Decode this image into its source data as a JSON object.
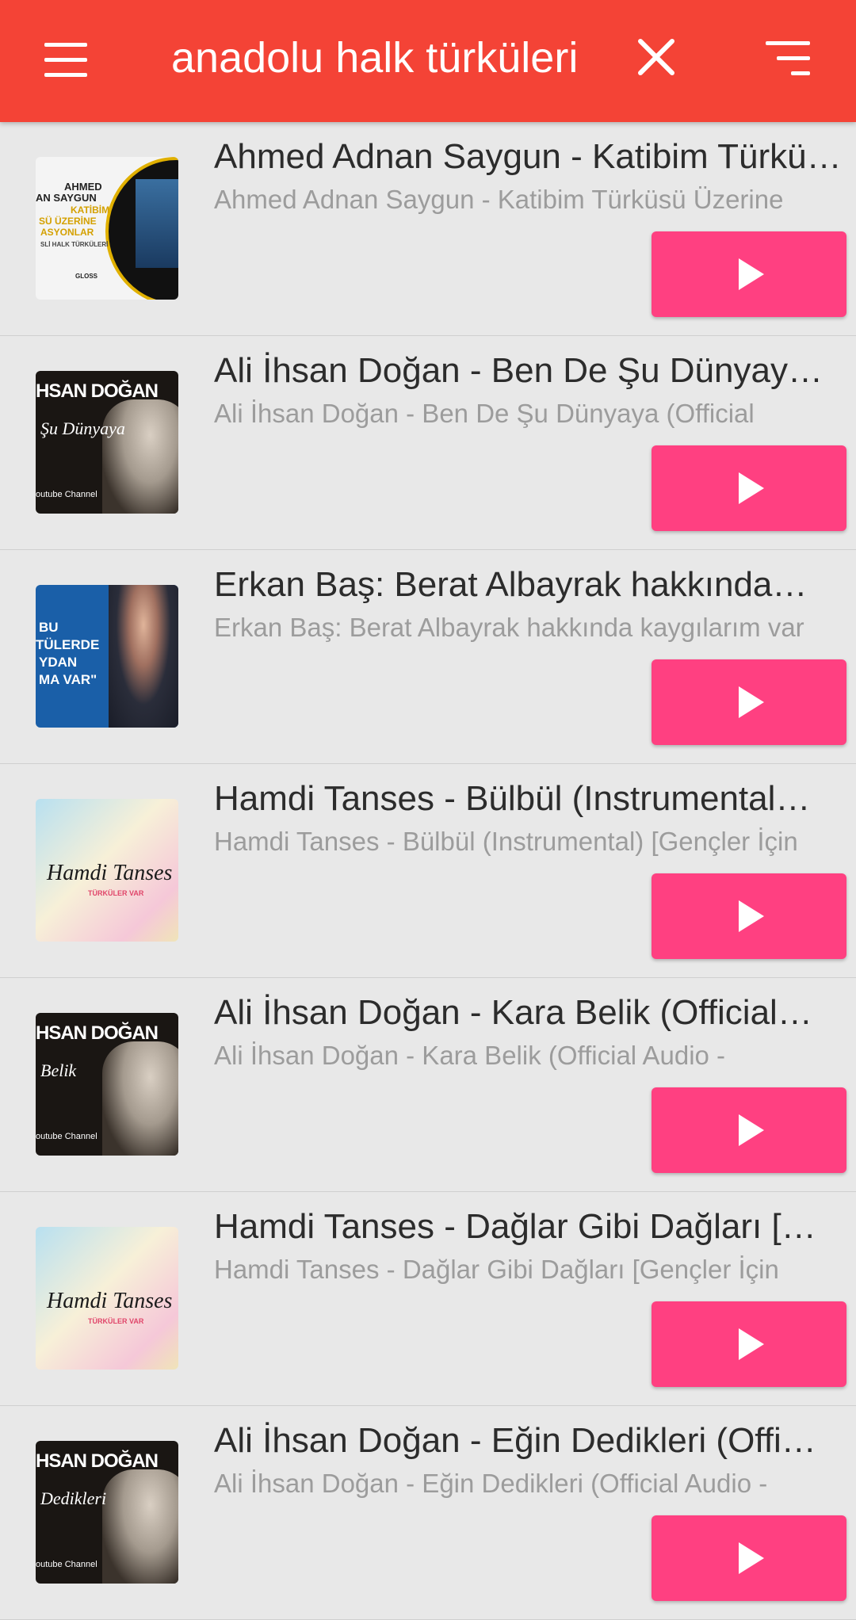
{
  "appbar": {
    "title": "anadolu halk türküleri",
    "icons": {
      "menu": "menu-icon",
      "close": "close-icon",
      "sort": "sort-icon"
    },
    "color": "#f44336"
  },
  "accent_color": "#ff4081",
  "items": [
    {
      "title": "Ahmed Adnan Saygun - Katibim Türkü…",
      "subtitle": "Ahmed Adnan Saygun - Katibim Türküsü Üzerine",
      "thumb_style": "white",
      "thumb_lines": [
        "AHMED",
        "AN SAYGUN",
        "KATİBİM",
        "SÜ ÜZERİNE",
        "ASYONLAR",
        "SLİ HALK TÜRKÜLERİ",
        "GLOSS"
      ]
    },
    {
      "title": "Ali İhsan Doğan - Ben De Şu Dünyay…",
      "subtitle": "Ali İhsan Doğan - Ben De Şu Dünyaya (Official",
      "thumb_style": "dark",
      "thumb_lines": [
        "HSAN DOĞAN",
        "Şu Dünyaya",
        "outube Channel"
      ]
    },
    {
      "title": "Erkan Baş: Berat Albayrak hakkında…",
      "subtitle": "Erkan Baş: Berat Albayrak hakkında kaygılarım var",
      "thumb_style": "blue",
      "thumb_lines": [
        "BU",
        "TÜLERDE",
        "YDAN",
        "MA VAR\""
      ]
    },
    {
      "title": "Hamdi Tanses - Bülbül (Instrumental…",
      "subtitle": "Hamdi Tanses - Bülbül (Instrumental) [Gençler İçin",
      "thumb_style": "pastel",
      "thumb_lines": [
        "Hamdi Tanses",
        "TÜRKÜLER VAR"
      ]
    },
    {
      "title": "Ali İhsan Doğan - Kara Belik (Official…",
      "subtitle": "Ali İhsan Doğan - Kara Belik (Official Audio -",
      "thumb_style": "dark",
      "thumb_lines": [
        "HSAN DOĞAN",
        "Belik",
        "outube Channel"
      ]
    },
    {
      "title": "Hamdi Tanses - Dağlar Gibi Dağları […",
      "subtitle": "Hamdi Tanses - Dağlar Gibi Dağları [Gençler İçin",
      "thumb_style": "pastel",
      "thumb_lines": [
        "Hamdi Tanses",
        "TÜRKÜLER VAR"
      ]
    },
    {
      "title": "Ali İhsan Doğan - Eğin Dedikleri (Offi…",
      "subtitle": "Ali İhsan Doğan - Eğin Dedikleri (Official Audio -",
      "thumb_style": "dark",
      "thumb_lines": [
        "HSAN DOĞAN",
        "Dedikleri",
        "outube Channel"
      ]
    }
  ]
}
